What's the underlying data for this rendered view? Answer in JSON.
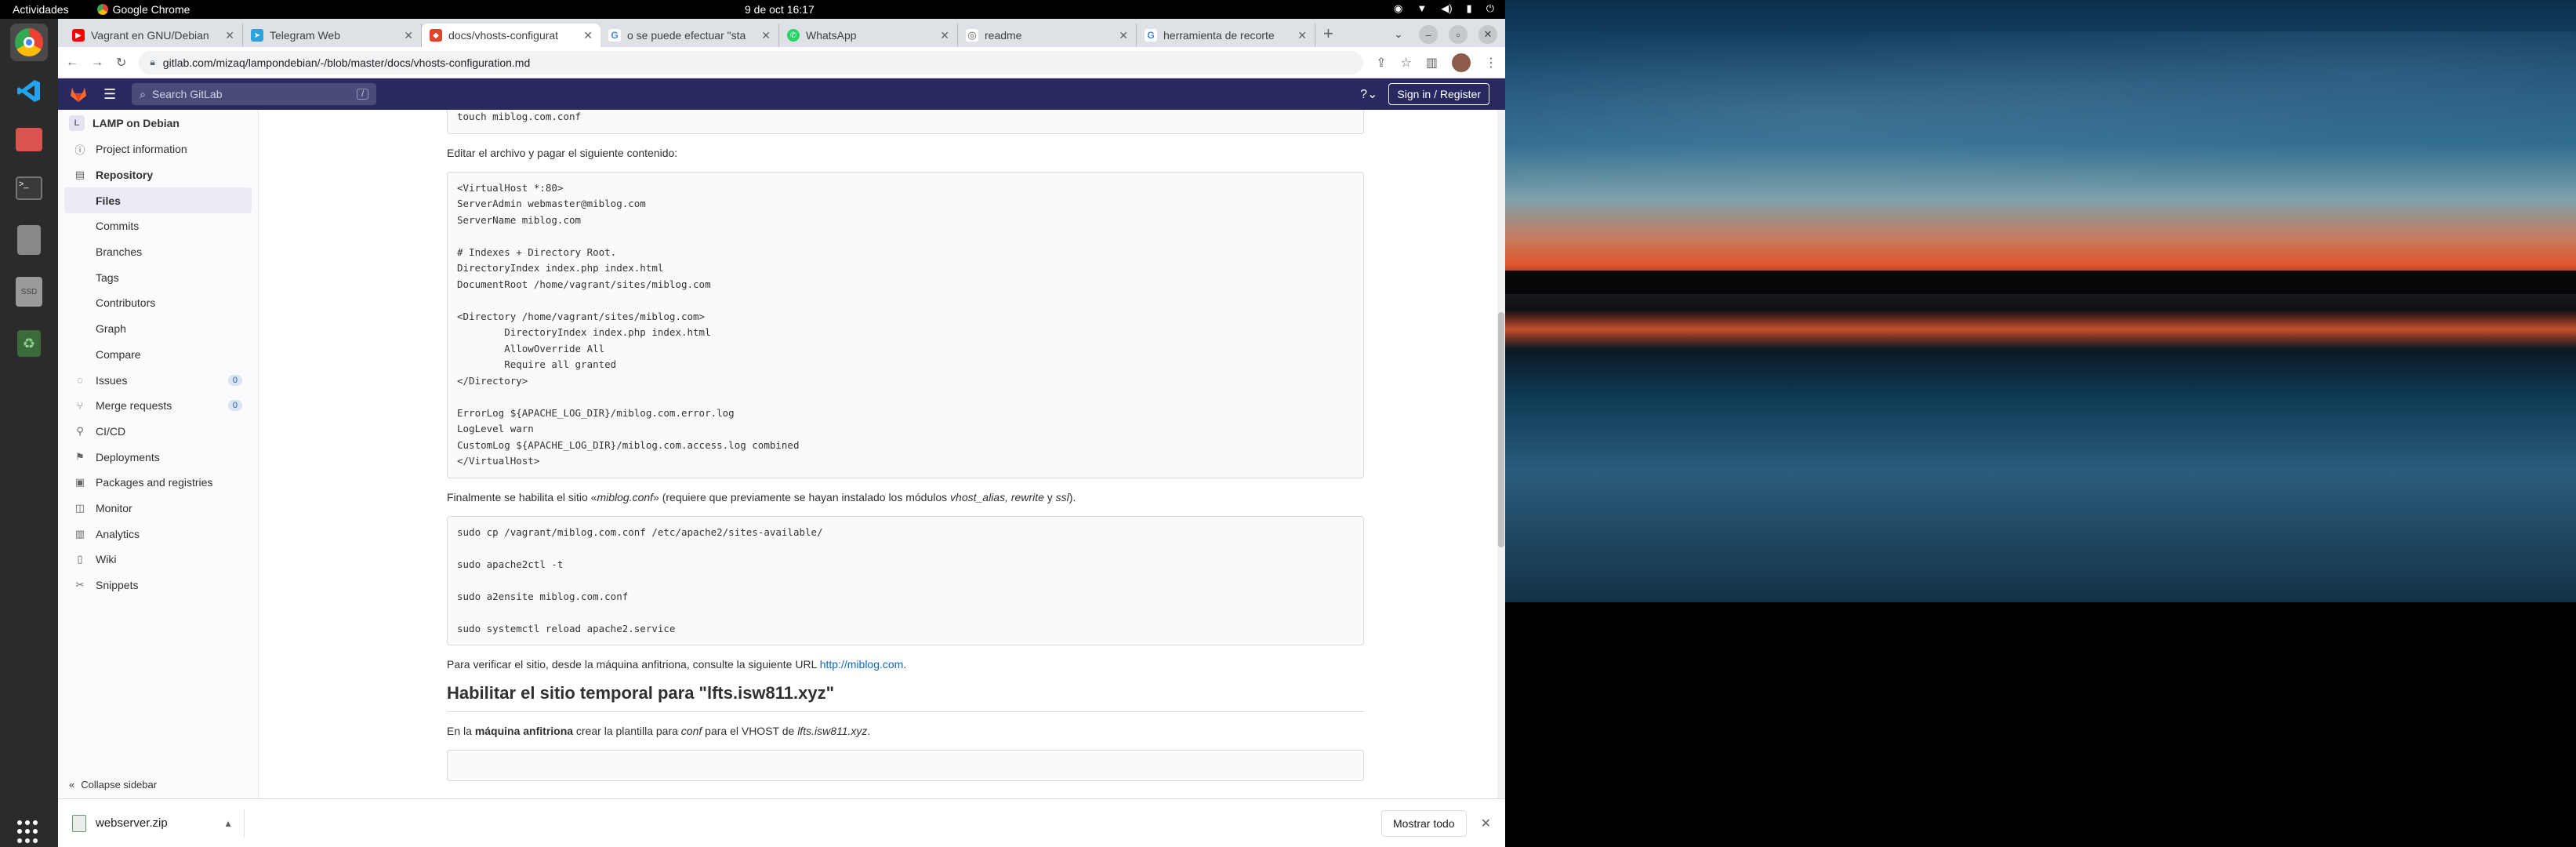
{
  "system": {
    "activities": "Actividades",
    "app_name": "Google Chrome",
    "clock": "9 de oct  16:17"
  },
  "browser": {
    "tabs": [
      {
        "title": "Vagrant en GNU/Debian",
        "favicon_color": "#ff0000"
      },
      {
        "title": "Telegram Web",
        "favicon_color": "#2aa3df"
      },
      {
        "title": "docs/vhosts-configurat",
        "favicon_color": "#e24329"
      },
      {
        "title": "o se puede efectuar \"sta",
        "favicon_color": "#4285f4"
      },
      {
        "title": "WhatsApp",
        "favicon_color": "#25d366"
      },
      {
        "title": "readme",
        "favicon_color": "#5f6368"
      },
      {
        "title": "herramienta de recorte",
        "favicon_color": "#4285f4"
      }
    ],
    "url": "gitlab.com/mizaq/lampondebian/-/blob/master/docs/vhosts-configuration.md"
  },
  "gitlab": {
    "search_placeholder": "Search GitLab",
    "search_shortcut": "/",
    "signin_label": "Sign in / Register",
    "project_name": "LAMP on Debian",
    "project_initial": "L",
    "nav": [
      {
        "label": "Project information",
        "icon": "info-icon",
        "type": "top"
      },
      {
        "label": "Repository",
        "icon": "doc-icon",
        "type": "top-bold"
      },
      {
        "label": "Files",
        "type": "sub-active"
      },
      {
        "label": "Commits",
        "type": "sub"
      },
      {
        "label": "Branches",
        "type": "sub"
      },
      {
        "label": "Tags",
        "type": "sub"
      },
      {
        "label": "Contributors",
        "type": "sub"
      },
      {
        "label": "Graph",
        "type": "sub"
      },
      {
        "label": "Compare",
        "type": "sub"
      },
      {
        "label": "Issues",
        "icon": "issues-icon",
        "type": "top",
        "count": "0"
      },
      {
        "label": "Merge requests",
        "icon": "merge-request-icon",
        "type": "top",
        "count": "0"
      },
      {
        "label": "CI/CD",
        "icon": "rocket-icon",
        "type": "top"
      },
      {
        "label": "Deployments",
        "icon": "deployments-icon",
        "type": "top"
      },
      {
        "label": "Packages and registries",
        "icon": "package-icon",
        "type": "top"
      },
      {
        "label": "Monitor",
        "icon": "monitor-icon",
        "type": "top"
      },
      {
        "label": "Analytics",
        "icon": "chart-icon",
        "type": "top"
      },
      {
        "label": "Wiki",
        "icon": "book-icon",
        "type": "top"
      },
      {
        "label": "Snippets",
        "icon": "snippet-icon",
        "type": "top"
      }
    ],
    "collapse_label": "Collapse sidebar"
  },
  "doc": {
    "code0": "touch miblog.com.conf",
    "p1": "Editar el archivo y pagar el siguiente contenido:",
    "code1": "<VirtualHost *:80>\nServerAdmin webmaster@miblog.com\nServerName miblog.com\n\n# Indexes + Directory Root.\nDirectoryIndex index.php index.html\nDocumentRoot /home/vagrant/sites/miblog.com\n\n<Directory /home/vagrant/sites/miblog.com>\n        DirectoryIndex index.php index.html\n        AllowOverride All\n        Require all granted\n</Directory>\n\nErrorLog ${APACHE_LOG_DIR}/miblog.com.error.log\nLogLevel warn\nCustomLog ${APACHE_LOG_DIR}/miblog.com.access.log combined\n</VirtualHost>",
    "p2_a": "Finalmente se habilita el sitio «",
    "p2_em1": "miblog.conf",
    "p2_b": "» (requiere que previamente se hayan instalado los módulos ",
    "p2_em2": "vhost_alias, rewrite",
    "p2_c": " y ",
    "p2_em3": "ssl",
    "p2_d": ").",
    "code2": "sudo cp /vagrant/miblog.com.conf /etc/apache2/sites-available/\n\nsudo apache2ctl -t\n\nsudo a2ensite miblog.com.conf\n\nsudo systemctl reload apache2.service",
    "p3_a": "Para verificar el sitio, desde la máquina anfitriona, consulte la siguiente URL ",
    "p3_link": "http://miblog.com",
    "p3_b": ".",
    "h2": "Habilitar el sitio temporal para \"lfts.isw811.xyz\"",
    "p4_a": "En la ",
    "p4_strong": "máquina anfitriona",
    "p4_b": " crear la plantilla para ",
    "p4_em1": "conf",
    "p4_c": " para el VHOST de ",
    "p4_em2": "lfts.isw811.xyz",
    "p4_d": "."
  },
  "downloads": {
    "file": "webserver.zip",
    "show_all": "Mostrar todo"
  }
}
